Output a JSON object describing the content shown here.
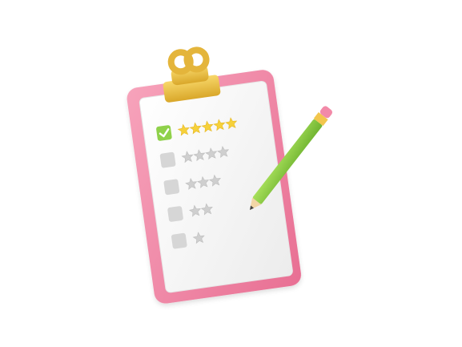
{
  "illustration": {
    "clipboard": {
      "board_color": "#f28aa8",
      "board_edge_color": "#e76f93",
      "paper_color": "#f7f7f7",
      "clip_color": "#f2c64d"
    },
    "checklist": [
      {
        "checked": true,
        "stars": 5
      },
      {
        "checked": false,
        "stars": 4
      },
      {
        "checked": false,
        "stars": 3
      },
      {
        "checked": false,
        "stars": 2
      },
      {
        "checked": false,
        "stars": 1
      }
    ],
    "pencil": {
      "body_color": "#8fd14a",
      "ferrule_color": "#f2c64d",
      "eraser_color": "#f28aa8",
      "tip_color": "#f2d6a6"
    },
    "icons": {
      "check": "check-icon",
      "star": "star-icon"
    },
    "colors": {
      "checkbox_on": "#8fd14a",
      "checkbox_off": "#d6d6d6",
      "star_on": "#f6d13a",
      "star_off": "#cfcfcf"
    }
  }
}
